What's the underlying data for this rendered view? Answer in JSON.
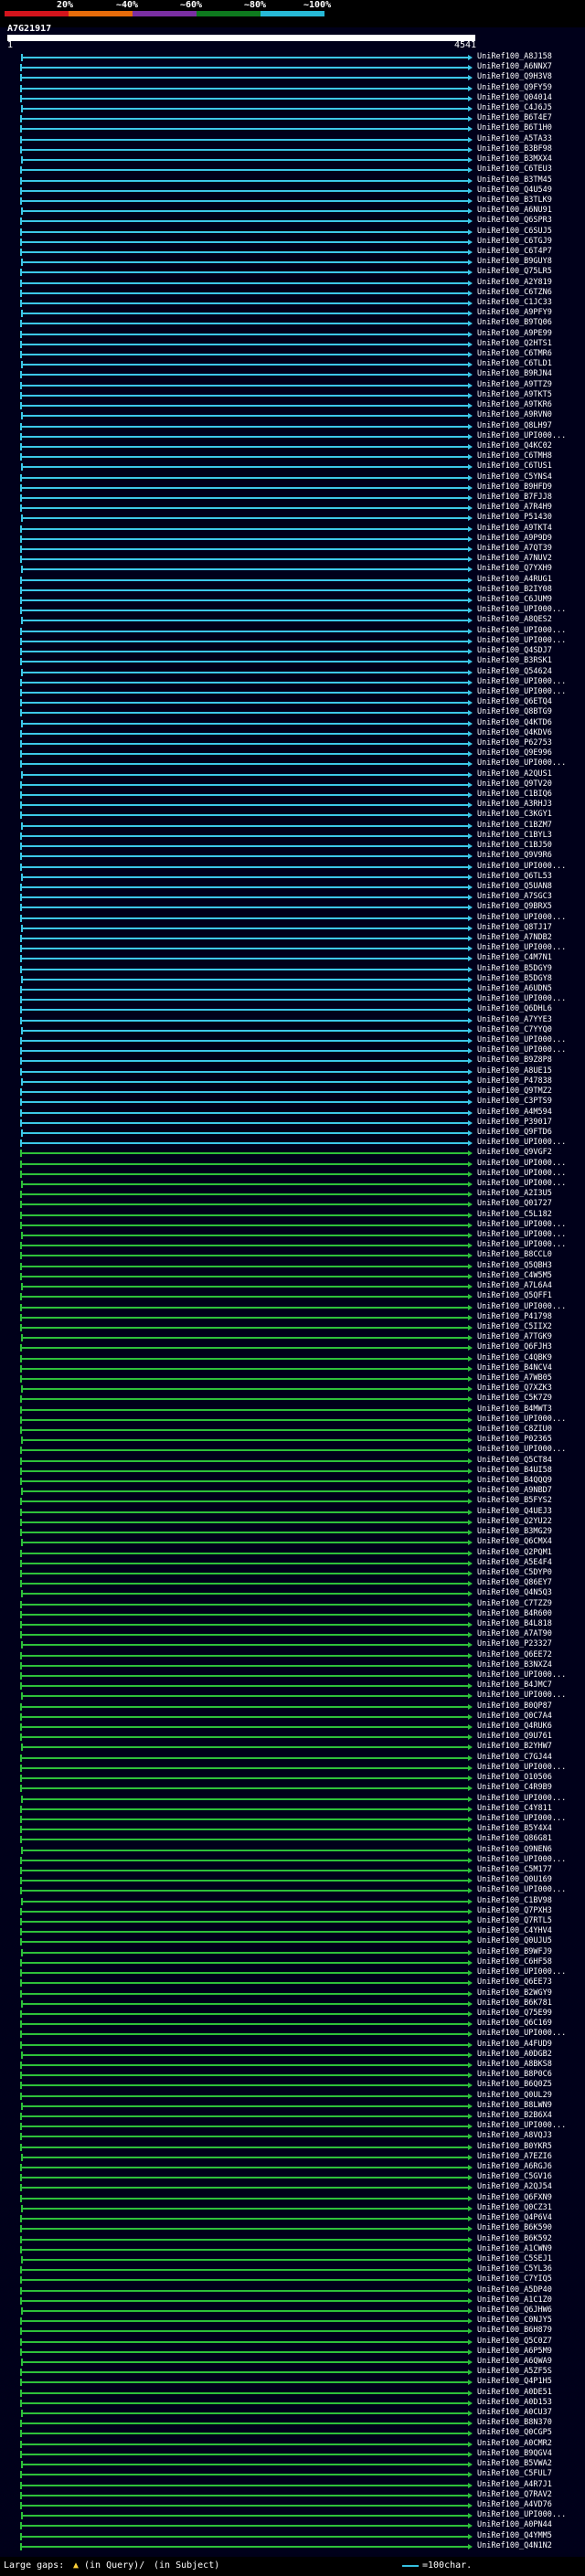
{
  "scale": {
    "labels": [
      "20%",
      "~40%",
      "~60%",
      "~80%",
      "~100%"
    ],
    "colors": [
      "#d4141c",
      "#e66b0a",
      "#7b2fa3",
      "#0e7a1e",
      "#27b8d6"
    ]
  },
  "query": {
    "id": "A7G21917",
    "start": "1",
    "end": "4541"
  },
  "hits": [
    {
      "label": "UniRef100_A8J158",
      "color": "#3cc8e8"
    },
    {
      "label": "UniRef100_A6NNX7",
      "color": "#3cc8e8"
    },
    {
      "label": "UniRef100_Q9H3V8",
      "color": "#3cc8e8"
    },
    {
      "label": "UniRef100_Q9FY59",
      "color": "#3cc8e8"
    },
    {
      "label": "UniRef100_Q04014",
      "color": "#3cc8e8"
    },
    {
      "label": "UniRef100_C4J6J5",
      "color": "#3cc8e8"
    },
    {
      "label": "UniRef100_B6T4E7",
      "color": "#3cc8e8"
    },
    {
      "label": "UniRef100_B6T1H0",
      "color": "#3cc8e8"
    },
    {
      "label": "UniRef100_A5TA33",
      "color": "#3cc8e8"
    },
    {
      "label": "UniRef100_B3BF98",
      "color": "#3cc8e8"
    },
    {
      "label": "UniRef100_B3MXX4",
      "color": "#3cc8e8"
    },
    {
      "label": "UniRef100_C6TEU3",
      "color": "#3cc8e8"
    },
    {
      "label": "UniRef100_B3TM45",
      "color": "#3cc8e8"
    },
    {
      "label": "UniRef100_Q4U549",
      "color": "#3cc8e8"
    },
    {
      "label": "UniRef100_B3TLK9",
      "color": "#3cc8e8"
    },
    {
      "label": "UniRef100_A6NU91",
      "color": "#3cc8e8"
    },
    {
      "label": "UniRef100_Q6SPR3",
      "color": "#3cc8e8"
    },
    {
      "label": "UniRef100_C6SUJ5",
      "color": "#3cc8e8"
    },
    {
      "label": "UniRef100_C6TGJ9",
      "color": "#3cc8e8"
    },
    {
      "label": "UniRef100_C6T4P7",
      "color": "#3cc8e8"
    },
    {
      "label": "UniRef100_B9GUY8",
      "color": "#3cc8e8"
    },
    {
      "label": "UniRef100_Q75LR5",
      "color": "#3cc8e8"
    },
    {
      "label": "UniRef100_A2Y819",
      "color": "#3cc8e8"
    },
    {
      "label": "UniRef100_C6TZN6",
      "color": "#3cc8e8"
    },
    {
      "label": "UniRef100_C1JC33",
      "color": "#3cc8e8"
    },
    {
      "label": "UniRef100_A9PFY9",
      "color": "#3cc8e8"
    },
    {
      "label": "UniRef100_B9TQ06",
      "color": "#3cc8e8"
    },
    {
      "label": "UniRef100_A9PE99",
      "color": "#3cc8e8"
    },
    {
      "label": "UniRef100_Q2HTS1",
      "color": "#3cc8e8"
    },
    {
      "label": "UniRef100_C6TMR6",
      "color": "#3cc8e8"
    },
    {
      "label": "UniRef100_C6TLD1",
      "color": "#3cc8e8"
    },
    {
      "label": "UniRef100_B9RJN4",
      "color": "#3cc8e8"
    },
    {
      "label": "UniRef100_A9TTZ9",
      "color": "#3cc8e8"
    },
    {
      "label": "UniRef100_A9TKT5",
      "color": "#3cc8e8"
    },
    {
      "label": "UniRef100_A9TKR6",
      "color": "#3cc8e8"
    },
    {
      "label": "UniRef100_A9RVN0",
      "color": "#3cc8e8"
    },
    {
      "label": "UniRef100_Q8LH97",
      "color": "#3cc8e8"
    },
    {
      "label": "UniRef100_UPI000...",
      "color": "#3cc8e8"
    },
    {
      "label": "UniRef100_Q4KC02",
      "color": "#3cc8e8"
    },
    {
      "label": "UniRef100_C6TMH8",
      "color": "#3cc8e8"
    },
    {
      "label": "UniRef100_C6TUS1",
      "color": "#3cc8e8"
    },
    {
      "label": "UniRef100_C5YNS4",
      "color": "#3cc8e8"
    },
    {
      "label": "UniRef100_B9HFD9",
      "color": "#3cc8e8"
    },
    {
      "label": "UniRef100_B7FJJ8",
      "color": "#3cc8e8"
    },
    {
      "label": "UniRef100_A7R4H9",
      "color": "#3cc8e8"
    },
    {
      "label": "UniRef100_P51430",
      "color": "#3cc8e8"
    },
    {
      "label": "UniRef100_A9TKT4",
      "color": "#3cc8e8"
    },
    {
      "label": "UniRef100_A9P9D9",
      "color": "#3cc8e8"
    },
    {
      "label": "UniRef100_A7QT39",
      "color": "#3cc8e8"
    },
    {
      "label": "UniRef100_A7NUV2",
      "color": "#3cc8e8"
    },
    {
      "label": "UniRef100_Q7YXH9",
      "color": "#3cc8e8"
    },
    {
      "label": "UniRef100_A4RUG1",
      "color": "#3cc8e8"
    },
    {
      "label": "UniRef100_B2IY08",
      "color": "#3cc8e8"
    },
    {
      "label": "UniRef100_C6JUM9",
      "color": "#3cc8e8"
    },
    {
      "label": "UniRef100_UPI000...",
      "color": "#3cc8e8"
    },
    {
      "label": "UniRef100_A8QES2",
      "color": "#3cc8e8"
    },
    {
      "label": "UniRef100_UPI000...",
      "color": "#3cc8e8"
    },
    {
      "label": "UniRef100_UPI000...",
      "color": "#3cc8e8"
    },
    {
      "label": "UniRef100_Q4SDJ7",
      "color": "#3cc8e8"
    },
    {
      "label": "UniRef100_B3RSK1",
      "color": "#3cc8e8"
    },
    {
      "label": "UniRef100_Q54624",
      "color": "#3cc8e8"
    },
    {
      "label": "UniRef100_UPI000...",
      "color": "#3cc8e8"
    },
    {
      "label": "UniRef100_UPI000...",
      "color": "#3cc8e8"
    },
    {
      "label": "UniRef100_Q6ETQ4",
      "color": "#3cc8e8"
    },
    {
      "label": "UniRef100_Q8BTG9",
      "color": "#3cc8e8"
    },
    {
      "label": "UniRef100_Q4KTD6",
      "color": "#3cc8e8"
    },
    {
      "label": "UniRef100_Q4KDV6",
      "color": "#3cc8e8"
    },
    {
      "label": "UniRef100_P62753",
      "color": "#3cc8e8"
    },
    {
      "label": "UniRef100_Q9E996",
      "color": "#3cc8e8"
    },
    {
      "label": "UniRef100_UPI000...",
      "color": "#3cc8e8"
    },
    {
      "label": "UniRef100_A2QUS1",
      "color": "#3cc8e8"
    },
    {
      "label": "UniRef100_Q9TV20",
      "color": "#3cc8e8"
    },
    {
      "label": "UniRef100_C1BIQ6",
      "color": "#3cc8e8"
    },
    {
      "label": "UniRef100_A3RHJ3",
      "color": "#3cc8e8"
    },
    {
      "label": "UniRef100_C3KGY1",
      "color": "#3cc8e8"
    },
    {
      "label": "UniRef100_C1BZM7",
      "color": "#3cc8e8"
    },
    {
      "label": "UniRef100_C1BYL3",
      "color": "#3cc8e8"
    },
    {
      "label": "UniRef100_C1BJ50",
      "color": "#3cc8e8"
    },
    {
      "label": "UniRef100_Q9V9R6",
      "color": "#3cc8e8"
    },
    {
      "label": "UniRef100_UPI000...",
      "color": "#3cc8e8"
    },
    {
      "label": "UniRef100_Q6TL53",
      "color": "#3cc8e8"
    },
    {
      "label": "UniRef100_Q5UAN8",
      "color": "#3cc8e8"
    },
    {
      "label": "UniRef100_A7SGC3",
      "color": "#3cc8e8"
    },
    {
      "label": "UniRef100_Q9BRX5",
      "color": "#3cc8e8"
    },
    {
      "label": "UniRef100_UPI000...",
      "color": "#3cc8e8"
    },
    {
      "label": "UniRef100_Q8TJ17",
      "color": "#3cc8e8"
    },
    {
      "label": "UniRef100_A7NDB2",
      "color": "#3cc8e8"
    },
    {
      "label": "UniRef100_UPI000...",
      "color": "#3cc8e8"
    },
    {
      "label": "UniRef100_C4M7N1",
      "color": "#3cc8e8"
    },
    {
      "label": "UniRef100_B5DGY9",
      "color": "#3cc8e8"
    },
    {
      "label": "UniRef100_B5DGY8",
      "color": "#3cc8e8"
    },
    {
      "label": "UniRef100_A6UDN5",
      "color": "#3cc8e8"
    },
    {
      "label": "UniRef100_UPI000...",
      "color": "#3cc8e8"
    },
    {
      "label": "UniRef100_Q6DHL6",
      "color": "#3cc8e8"
    },
    {
      "label": "UniRef100_A7YYE3",
      "color": "#3cc8e8"
    },
    {
      "label": "UniRef100_C7YYQ0",
      "color": "#3cc8e8"
    },
    {
      "label": "UniRef100_UPI000...",
      "color": "#3cc8e8"
    },
    {
      "label": "UniRef100_UPI000...",
      "color": "#3cc8e8"
    },
    {
      "label": "UniRef100_B9Z8P8",
      "color": "#3cc8e8"
    },
    {
      "label": "UniRef100_A8UE15",
      "color": "#3cc8e8"
    },
    {
      "label": "UniRef100_P47838",
      "color": "#3cc8e8"
    },
    {
      "label": "UniRef100_Q9TMZ2",
      "color": "#3cc8e8"
    },
    {
      "label": "UniRef100_C3PTS9",
      "color": "#3cc8e8"
    },
    {
      "label": "UniRef100_A4M594",
      "color": "#3cc8e8"
    },
    {
      "label": "UniRef100_P39017",
      "color": "#3cc8e8"
    },
    {
      "label": "UniRef100_Q9FTD6",
      "color": "#3cc8e8"
    },
    {
      "label": "UniRef100_UPI000...",
      "color": "#3cc8e8"
    },
    {
      "label": "UniRef100_Q9VGF2",
      "color": "#2ec03a"
    },
    {
      "label": "UniRef100_UPI000...",
      "color": "#2ec03a"
    },
    {
      "label": "UniRef100_UPI000...",
      "color": "#2ec03a"
    },
    {
      "label": "UniRef100_UPI000...",
      "color": "#2ec03a"
    },
    {
      "label": "UniRef100_A2I3U5",
      "color": "#2ec03a"
    },
    {
      "label": "UniRef100_Q01727",
      "color": "#2ec03a"
    },
    {
      "label": "UniRef100_C5L182",
      "color": "#2ec03a"
    },
    {
      "label": "UniRef100_UPI000...",
      "color": "#2ec03a"
    },
    {
      "label": "UniRef100_UPI000...",
      "color": "#2ec03a"
    },
    {
      "label": "UniRef100_UPI000...",
      "color": "#2ec03a"
    },
    {
      "label": "UniRef100_B8CCL0",
      "color": "#2ec03a"
    },
    {
      "label": "UniRef100_Q5QBH3",
      "color": "#2ec03a"
    },
    {
      "label": "UniRef100_C4W5M5",
      "color": "#2ec03a"
    },
    {
      "label": "UniRef100_A7L6A4",
      "color": "#2ec03a"
    },
    {
      "label": "UniRef100_Q5QFF1",
      "color": "#2ec03a"
    },
    {
      "label": "UniRef100_UPI000...",
      "color": "#2ec03a"
    },
    {
      "label": "UniRef100_P41798",
      "color": "#2ec03a"
    },
    {
      "label": "UniRef100_C5IIX2",
      "color": "#2ec03a"
    },
    {
      "label": "UniRef100_A7TGK9",
      "color": "#2ec03a"
    },
    {
      "label": "UniRef100_Q6FJH3",
      "color": "#2ec03a"
    },
    {
      "label": "UniRef100_C4QBK9",
      "color": "#2ec03a"
    },
    {
      "label": "UniRef100_B4NCV4",
      "color": "#2ec03a"
    },
    {
      "label": "UniRef100_A7WB05",
      "color": "#2ec03a"
    },
    {
      "label": "UniRef100_Q7XZK3",
      "color": "#2ec03a"
    },
    {
      "label": "UniRef100_C5K7Z9",
      "color": "#2ec03a"
    },
    {
      "label": "UniRef100_B4MWT3",
      "color": "#2ec03a"
    },
    {
      "label": "UniRef100_UPI000...",
      "color": "#2ec03a"
    },
    {
      "label": "UniRef100_C8ZIU0",
      "color": "#2ec03a"
    },
    {
      "label": "UniRef100_P02365",
      "color": "#2ec03a"
    },
    {
      "label": "UniRef100_UPI000...",
      "color": "#2ec03a"
    },
    {
      "label": "UniRef100_Q5CT84",
      "color": "#2ec03a"
    },
    {
      "label": "UniRef100_B4UI58",
      "color": "#2ec03a"
    },
    {
      "label": "UniRef100_B4QQQ9",
      "color": "#2ec03a"
    },
    {
      "label": "UniRef100_A9NBD7",
      "color": "#2ec03a"
    },
    {
      "label": "UniRef100_B5FYS2",
      "color": "#2ec03a"
    },
    {
      "label": "UniRef100_Q4UEJ3",
      "color": "#2ec03a"
    },
    {
      "label": "UniRef100_Q2YU22",
      "color": "#2ec03a"
    },
    {
      "label": "UniRef100_B3MG29",
      "color": "#2ec03a"
    },
    {
      "label": "UniRef100_Q6CMX4",
      "color": "#2ec03a"
    },
    {
      "label": "UniRef100_Q2PQM1",
      "color": "#2ec03a"
    },
    {
      "label": "UniRef100_A5E4F4",
      "color": "#2ec03a"
    },
    {
      "label": "UniRef100_C5DYP0",
      "color": "#2ec03a"
    },
    {
      "label": "UniRef100_Q86EY7",
      "color": "#2ec03a"
    },
    {
      "label": "UniRef100_Q4N5Q3",
      "color": "#2ec03a"
    },
    {
      "label": "UniRef100_C7TZZ9",
      "color": "#2ec03a"
    },
    {
      "label": "UniRef100_B4R600",
      "color": "#2ec03a"
    },
    {
      "label": "UniRef100_B4L818",
      "color": "#2ec03a"
    },
    {
      "label": "UniRef100_A7AT90",
      "color": "#2ec03a"
    },
    {
      "label": "UniRef100_P23327",
      "color": "#2ec03a"
    },
    {
      "label": "UniRef100_Q6EE72",
      "color": "#2ec03a"
    },
    {
      "label": "UniRef100_B3NXZ4",
      "color": "#2ec03a"
    },
    {
      "label": "UniRef100_UPI000...",
      "color": "#2ec03a"
    },
    {
      "label": "UniRef100_B4JMC7",
      "color": "#2ec03a"
    },
    {
      "label": "UniRef100_UPI000...",
      "color": "#2ec03a"
    },
    {
      "label": "UniRef100_B0QP87",
      "color": "#2ec03a"
    },
    {
      "label": "UniRef100_Q0C7A4",
      "color": "#2ec03a"
    },
    {
      "label": "UniRef100_Q4RUK6",
      "color": "#2ec03a"
    },
    {
      "label": "UniRef100_Q9U761",
      "color": "#2ec03a"
    },
    {
      "label": "UniRef100_B2YHW7",
      "color": "#2ec03a"
    },
    {
      "label": "UniRef100_C7GJ44",
      "color": "#2ec03a"
    },
    {
      "label": "UniRef100_UPI000...",
      "color": "#2ec03a"
    },
    {
      "label": "UniRef100_O10506",
      "color": "#2ec03a"
    },
    {
      "label": "UniRef100_C4R9B9",
      "color": "#2ec03a"
    },
    {
      "label": "UniRef100_UPI000...",
      "color": "#2ec03a"
    },
    {
      "label": "UniRef100_C4Y811",
      "color": "#2ec03a"
    },
    {
      "label": "UniRef100_UPI000...",
      "color": "#2ec03a"
    },
    {
      "label": "UniRef100_B5Y4X4",
      "color": "#2ec03a"
    },
    {
      "label": "UniRef100_Q86G81",
      "color": "#2ec03a"
    },
    {
      "label": "UniRef100_Q9NEN6",
      "color": "#2ec03a"
    },
    {
      "label": "UniRef100_UPI000...",
      "color": "#2ec03a"
    },
    {
      "label": "UniRef100_C5M177",
      "color": "#2ec03a"
    },
    {
      "label": "UniRef100_Q0U169",
      "color": "#2ec03a"
    },
    {
      "label": "UniRef100_UPI000...",
      "color": "#2ec03a"
    },
    {
      "label": "UniRef100_C1BV98",
      "color": "#2ec03a"
    },
    {
      "label": "UniRef100_Q7PXH3",
      "color": "#2ec03a"
    },
    {
      "label": "UniRef100_Q7RTL5",
      "color": "#2ec03a"
    },
    {
      "label": "UniRef100_C4YHV4",
      "color": "#2ec03a"
    },
    {
      "label": "UniRef100_Q0UJU5",
      "color": "#2ec03a"
    },
    {
      "label": "UniRef100_B9WFJ9",
      "color": "#2ec03a"
    },
    {
      "label": "UniRef100_C6HF58",
      "color": "#2ec03a"
    },
    {
      "label": "UniRef100_UPI000...",
      "color": "#2ec03a"
    },
    {
      "label": "UniRef100_Q6EE73",
      "color": "#2ec03a"
    },
    {
      "label": "UniRef100_B2WGY9",
      "color": "#2ec03a"
    },
    {
      "label": "UniRef100_B6K781",
      "color": "#2ec03a"
    },
    {
      "label": "UniRef100_Q75E99",
      "color": "#2ec03a"
    },
    {
      "label": "UniRef100_Q6C169",
      "color": "#2ec03a"
    },
    {
      "label": "UniRef100_UPI000...",
      "color": "#2ec03a"
    },
    {
      "label": "UniRef100_A4FUD9",
      "color": "#2ec03a"
    },
    {
      "label": "UniRef100_A0DGB2",
      "color": "#2ec03a"
    },
    {
      "label": "UniRef100_A8BKS8",
      "color": "#2ec03a"
    },
    {
      "label": "UniRef100_B8P0C6",
      "color": "#2ec03a"
    },
    {
      "label": "UniRef100_B6Q0Z5",
      "color": "#2ec03a"
    },
    {
      "label": "UniRef100_Q0UL29",
      "color": "#2ec03a"
    },
    {
      "label": "UniRef100_B8LWN9",
      "color": "#2ec03a"
    },
    {
      "label": "UniRef100_B2B6X4",
      "color": "#2ec03a"
    },
    {
      "label": "UniRef100_UPI000...",
      "color": "#2ec03a"
    },
    {
      "label": "UniRef100_A8VQJ3",
      "color": "#2ec03a"
    },
    {
      "label": "UniRef100_B0YKR5",
      "color": "#2ec03a"
    },
    {
      "label": "UniRef100_A7EZI6",
      "color": "#2ec03a"
    },
    {
      "label": "UniRef100_A6RGJ6",
      "color": "#2ec03a"
    },
    {
      "label": "UniRef100_C5GV16",
      "color": "#2ec03a"
    },
    {
      "label": "UniRef100_A2QJ54",
      "color": "#2ec03a"
    },
    {
      "label": "UniRef100_Q6FXN9",
      "color": "#2ec03a"
    },
    {
      "label": "UniRef100_Q0CZ31",
      "color": "#2ec03a"
    },
    {
      "label": "UniRef100_Q4P6V4",
      "color": "#2ec03a"
    },
    {
      "label": "UniRef100_B6K590",
      "color": "#2ec03a"
    },
    {
      "label": "UniRef100_B6K592",
      "color": "#2ec03a"
    },
    {
      "label": "UniRef100_A1CWN9",
      "color": "#2ec03a"
    },
    {
      "label": "UniRef100_C5SEJ1",
      "color": "#2ec03a"
    },
    {
      "label": "UniRef100_C5YL36",
      "color": "#2ec03a"
    },
    {
      "label": "UniRef100_C7YIQ5",
      "color": "#2ec03a"
    },
    {
      "label": "UniRef100_A5DP40",
      "color": "#2ec03a"
    },
    {
      "label": "UniRef100_A1C1Z0",
      "color": "#2ec03a"
    },
    {
      "label": "UniRef100_Q6JHW6",
      "color": "#2ec03a"
    },
    {
      "label": "UniRef100_C0NJY5",
      "color": "#2ec03a"
    },
    {
      "label": "UniRef100_B6H879",
      "color": "#2ec03a"
    },
    {
      "label": "UniRef100_Q5C0Z7",
      "color": "#2ec03a"
    },
    {
      "label": "UniRef100_A6P5M9",
      "color": "#2ec03a"
    },
    {
      "label": "UniRef100_A6QWA9",
      "color": "#2ec03a"
    },
    {
      "label": "UniRef100_A5ZF5S",
      "color": "#2ec03a"
    },
    {
      "label": "UniRef100_Q4P1H5",
      "color": "#2ec03a"
    },
    {
      "label": "UniRef100_A0DE51",
      "color": "#2ec03a"
    },
    {
      "label": "UniRef100_A0D153",
      "color": "#2ec03a"
    },
    {
      "label": "UniRef100_A0CU37",
      "color": "#2ec03a"
    },
    {
      "label": "UniRef100_B8N370",
      "color": "#2ec03a"
    },
    {
      "label": "UniRef100_Q0CGP5",
      "color": "#2ec03a"
    },
    {
      "label": "UniRef100_A0CMR2",
      "color": "#2ec03a"
    },
    {
      "label": "UniRef100_B9QGV4",
      "color": "#2ec03a"
    },
    {
      "label": "UniRef100_B5VWA2",
      "color": "#2ec03a"
    },
    {
      "label": "UniRef100_C5FUL7",
      "color": "#2ec03a"
    },
    {
      "label": "UniRef100_A4R7J1",
      "color": "#2ec03a"
    },
    {
      "label": "UniRef100_Q7RAV2",
      "color": "#2ec03a"
    },
    {
      "label": "UniRef100_A4VD76",
      "color": "#2ec03a"
    },
    {
      "label": "UniRef100_UPI000...",
      "color": "#2ec03a"
    },
    {
      "label": "UniRef100_A0PN44",
      "color": "#2ec03a"
    },
    {
      "label": "UniRef100_Q4YMM5",
      "color": "#2ec03a"
    },
    {
      "label": "UniRef100_Q4N1N2",
      "color": "#2ec03a"
    }
  ],
  "footer": {
    "large_gaps": "Large gaps:",
    "in_query": "(in Query)/",
    "in_subject": "(in Subject)",
    "scale_label": "=100char."
  }
}
